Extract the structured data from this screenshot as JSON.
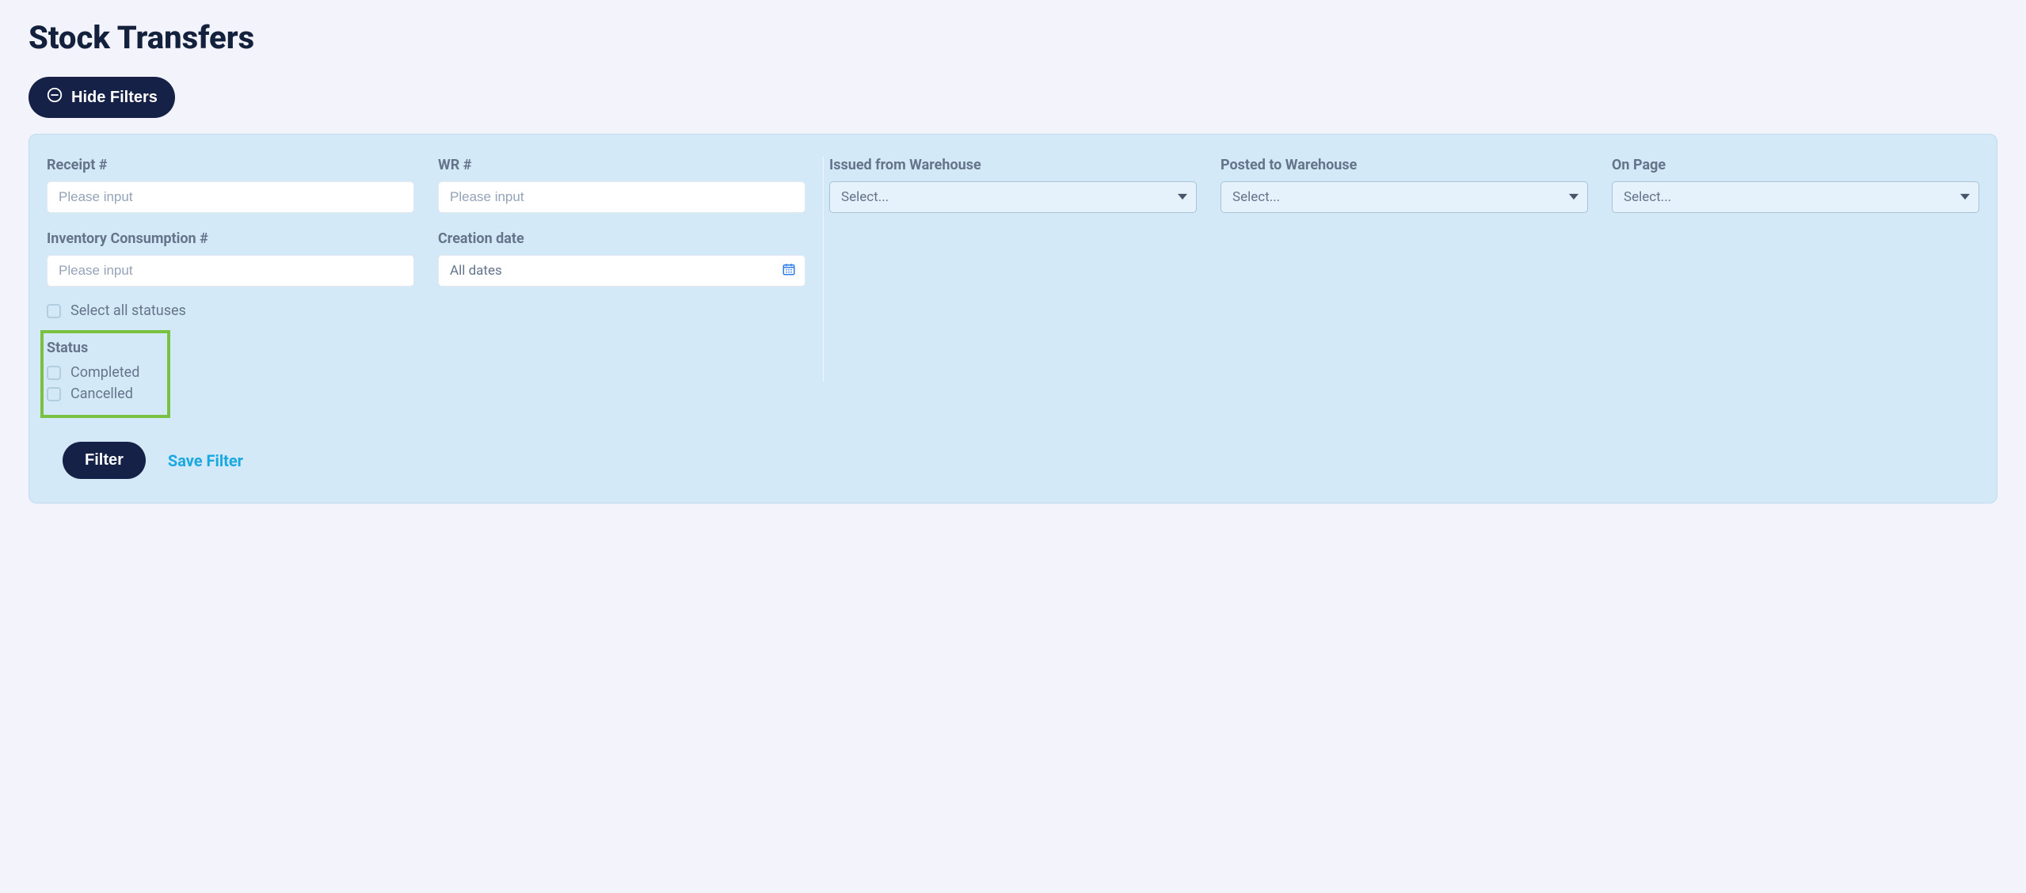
{
  "page": {
    "title": "Stock Transfers",
    "hide_filters_label": "Hide Filters"
  },
  "filters": {
    "receipt": {
      "label": "Receipt #",
      "placeholder": "Please input",
      "value": ""
    },
    "wr": {
      "label": "WR #",
      "placeholder": "Please input",
      "value": ""
    },
    "issued_from": {
      "label": "Issued from Warehouse",
      "placeholder": "Select...",
      "value": ""
    },
    "posted_to": {
      "label": "Posted to Warehouse",
      "placeholder": "Select...",
      "value": ""
    },
    "on_page": {
      "label": "On Page",
      "placeholder": "Select...",
      "value": ""
    },
    "inventory_consumption": {
      "label": "Inventory Consumption #",
      "placeholder": "Please input",
      "value": ""
    },
    "creation_date": {
      "label": "Creation date",
      "placeholder": "All dates",
      "value": ""
    }
  },
  "status": {
    "select_all_label": "Select all statuses",
    "heading": "Status",
    "options": [
      {
        "label": "Completed",
        "checked": false
      },
      {
        "label": "Cancelled",
        "checked": false
      }
    ]
  },
  "actions": {
    "filter_label": "Filter",
    "save_filter_label": "Save Filter"
  }
}
